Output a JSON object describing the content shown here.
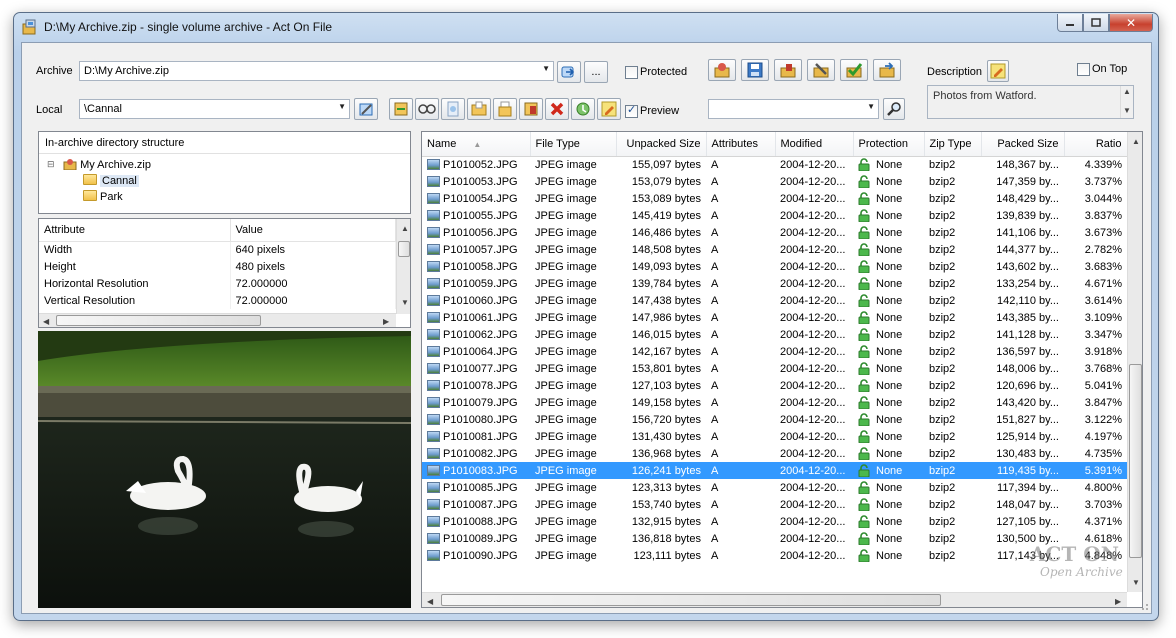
{
  "window": {
    "title": "D:\\My Archive.zip - single volume archive - Act On File",
    "buttons": [
      "minimize",
      "maximize",
      "close"
    ]
  },
  "archive": {
    "label": "Archive",
    "value": "D:\\My Archive.zip",
    "browse": "..."
  },
  "local": {
    "label": "Local",
    "value": "\\Cannal"
  },
  "options": {
    "protected_label": "Protected",
    "protected": false,
    "preview_label": "Preview",
    "preview": true
  },
  "search": {
    "value": ""
  },
  "description": {
    "label": "Description",
    "text": "Photos from Watford."
  },
  "on_top": {
    "label": "On Top",
    "checked": false
  },
  "tree": {
    "header": "In-archive directory structure",
    "root": "My Archive.zip",
    "children": [
      "Cannal",
      "Park"
    ],
    "selected": "Cannal"
  },
  "attributes": {
    "columns": [
      "Attribute",
      "Value"
    ],
    "rows": [
      [
        "Width",
        "640 pixels"
      ],
      [
        "Height",
        "480 pixels"
      ],
      [
        "Horizontal Resolution",
        "72.000000"
      ],
      [
        "Vertical Resolution",
        "72.000000"
      ]
    ]
  },
  "files": {
    "columns": [
      "Name",
      "File Type",
      "Unpacked Size",
      "Attributes",
      "Modified",
      "Protection",
      "Zip Type",
      "Packed Size",
      "Ratio"
    ],
    "selected_index": 18,
    "rows": [
      [
        "P1010052.JPG",
        "JPEG image",
        "155,097 bytes",
        "A",
        "2004-12-20...",
        "None",
        "bzip2",
        "148,367 by...",
        "4.339%"
      ],
      [
        "P1010053.JPG",
        "JPEG image",
        "153,079 bytes",
        "A",
        "2004-12-20...",
        "None",
        "bzip2",
        "147,359 by...",
        "3.737%"
      ],
      [
        "P1010054.JPG",
        "JPEG image",
        "153,089 bytes",
        "A",
        "2004-12-20...",
        "None",
        "bzip2",
        "148,429 by...",
        "3.044%"
      ],
      [
        "P1010055.JPG",
        "JPEG image",
        "145,419 bytes",
        "A",
        "2004-12-20...",
        "None",
        "bzip2",
        "139,839 by...",
        "3.837%"
      ],
      [
        "P1010056.JPG",
        "JPEG image",
        "146,486 bytes",
        "A",
        "2004-12-20...",
        "None",
        "bzip2",
        "141,106 by...",
        "3.673%"
      ],
      [
        "P1010057.JPG",
        "JPEG image",
        "148,508 bytes",
        "A",
        "2004-12-20...",
        "None",
        "bzip2",
        "144,377 by...",
        "2.782%"
      ],
      [
        "P1010058.JPG",
        "JPEG image",
        "149,093 bytes",
        "A",
        "2004-12-20...",
        "None",
        "bzip2",
        "143,602 by...",
        "3.683%"
      ],
      [
        "P1010059.JPG",
        "JPEG image",
        "139,784 bytes",
        "A",
        "2004-12-20...",
        "None",
        "bzip2",
        "133,254 by...",
        "4.671%"
      ],
      [
        "P1010060.JPG",
        "JPEG image",
        "147,438 bytes",
        "A",
        "2004-12-20...",
        "None",
        "bzip2",
        "142,110 by...",
        "3.614%"
      ],
      [
        "P1010061.JPG",
        "JPEG image",
        "147,986 bytes",
        "A",
        "2004-12-20...",
        "None",
        "bzip2",
        "143,385 by...",
        "3.109%"
      ],
      [
        "P1010062.JPG",
        "JPEG image",
        "146,015 bytes",
        "A",
        "2004-12-20...",
        "None",
        "bzip2",
        "141,128 by...",
        "3.347%"
      ],
      [
        "P1010064.JPG",
        "JPEG image",
        "142,167 bytes",
        "A",
        "2004-12-20...",
        "None",
        "bzip2",
        "136,597 by...",
        "3.918%"
      ],
      [
        "P1010077.JPG",
        "JPEG image",
        "153,801 bytes",
        "A",
        "2004-12-20...",
        "None",
        "bzip2",
        "148,006 by...",
        "3.768%"
      ],
      [
        "P1010078.JPG",
        "JPEG image",
        "127,103 bytes",
        "A",
        "2004-12-20...",
        "None",
        "bzip2",
        "120,696 by...",
        "5.041%"
      ],
      [
        "P1010079.JPG",
        "JPEG image",
        "149,158 bytes",
        "A",
        "2004-12-20...",
        "None",
        "bzip2",
        "143,420 by...",
        "3.847%"
      ],
      [
        "P1010080.JPG",
        "JPEG image",
        "156,720 bytes",
        "A",
        "2004-12-20...",
        "None",
        "bzip2",
        "151,827 by...",
        "3.122%"
      ],
      [
        "P1010081.JPG",
        "JPEG image",
        "131,430 bytes",
        "A",
        "2004-12-20...",
        "None",
        "bzip2",
        "125,914 by...",
        "4.197%"
      ],
      [
        "P1010082.JPG",
        "JPEG image",
        "136,968 bytes",
        "A",
        "2004-12-20...",
        "None",
        "bzip2",
        "130,483 by...",
        "4.735%"
      ],
      [
        "P1010083.JPG",
        "JPEG image",
        "126,241 bytes",
        "A",
        "2004-12-20...",
        "None",
        "bzip2",
        "119,435 by...",
        "5.391%"
      ],
      [
        "P1010085.JPG",
        "JPEG image",
        "123,313 bytes",
        "A",
        "2004-12-20...",
        "None",
        "bzip2",
        "117,394 by...",
        "4.800%"
      ],
      [
        "P1010087.JPG",
        "JPEG image",
        "153,740 bytes",
        "A",
        "2004-12-20...",
        "None",
        "bzip2",
        "148,047 by...",
        "3.703%"
      ],
      [
        "P1010088.JPG",
        "JPEG image",
        "132,915 bytes",
        "A",
        "2004-12-20...",
        "None",
        "bzip2",
        "127,105 by...",
        "4.371%"
      ],
      [
        "P1010089.JPG",
        "JPEG image",
        "136,818 bytes",
        "A",
        "2004-12-20...",
        "None",
        "bzip2",
        "130,500 by...",
        "4.618%"
      ],
      [
        "P1010090.JPG",
        "JPEG image",
        "123,111 bytes",
        "A",
        "2004-12-20...",
        "None",
        "bzip2",
        "117,143 by...",
        "4.848%"
      ]
    ]
  },
  "watermark": {
    "line1": "ACT ON",
    "line2": "Open Archive"
  },
  "colors": {
    "selection": "#3399ff",
    "window_frame": "#b9d0ea",
    "client": "#f0f0f0"
  },
  "icons": [
    "archive-app-icon",
    "go-arrow-icon",
    "settings-wrench-icon",
    "view-glasses-icon",
    "delete-x-icon",
    "edit-pencil-icon",
    "search-magnifier-icon",
    "folder-icon",
    "image-file-icon",
    "lock-icon"
  ]
}
